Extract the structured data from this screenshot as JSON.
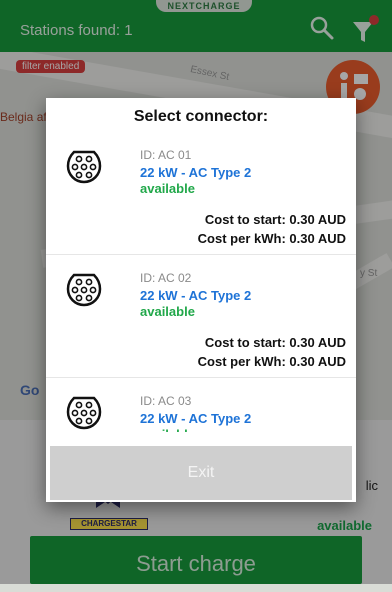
{
  "app": {
    "brand": "NEXTCHARGE",
    "stations_found": "Stations found: 1",
    "filter_badge": "filter enabled"
  },
  "map": {
    "street_essex": "Essex St",
    "poi_text": "Belgia\nafe H",
    "side_street": "y St",
    "google_letters": "Go"
  },
  "sheet": {
    "partial_text": "lic",
    "logo_text": "CHARGESTAR",
    "status": "available",
    "start_button": "Start charge"
  },
  "dialog": {
    "title": "Select connector:",
    "exit_button": "Exit",
    "connectors": [
      {
        "id": "ID: AC 01",
        "power": "22 kW - AC  Type 2",
        "status": "available",
        "cost_start": "Cost to start: 0.30 AUD",
        "cost_kwh": "Cost per kWh: 0.30 AUD"
      },
      {
        "id": "ID: AC 02",
        "power": "22 kW - AC  Type 2",
        "status": "available",
        "cost_start": "Cost to start: 0.30 AUD",
        "cost_kwh": "Cost per kWh: 0.30 AUD"
      },
      {
        "id": "ID: AC 03",
        "power": "22 kW - AC  Type 2",
        "status": "available",
        "cost_start": "",
        "cost_kwh": ""
      }
    ]
  },
  "colors": {
    "brand_green": "#179b3d",
    "link_blue": "#1e73d7",
    "status_green": "#21a84a",
    "fab_orange": "#ec5d2d"
  }
}
